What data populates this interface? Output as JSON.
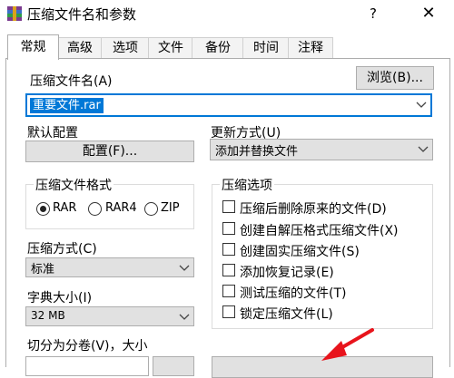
{
  "window": {
    "title": "压缩文件名和参数",
    "help": "?",
    "close": "✕"
  },
  "tabs": [
    "常规",
    "高级",
    "选项",
    "文件",
    "备份",
    "时间",
    "注释"
  ],
  "archive": {
    "label": "压缩文件名(A)",
    "browse_button": "浏览(B)...",
    "value": "重要文件.rar"
  },
  "profile": {
    "label": "默认配置",
    "button": "配置(F)..."
  },
  "update": {
    "label": "更新方式(U)",
    "value": "添加并替换文件"
  },
  "format": {
    "label": "压缩文件格式",
    "options": [
      "RAR",
      "RAR4",
      "ZIP"
    ],
    "selected": "RAR"
  },
  "method": {
    "label": "压缩方式(C)",
    "value": "标准"
  },
  "dictionary": {
    "label": "字典大小(I)",
    "value": "32 MB"
  },
  "split": {
    "label": "切分为分卷(V)，大小"
  },
  "options": {
    "label": "压缩选项",
    "items": [
      "压缩后删除原来的文件(D)",
      "创建自解压格式压缩文件(X)",
      "创建固实压缩文件(S)",
      "添加恢复记录(E)",
      "测试压缩的文件(T)",
      "锁定压缩文件(L)"
    ]
  },
  "colors": {
    "accent": "#0078d7",
    "annotation_arrow": "#e8141c"
  }
}
